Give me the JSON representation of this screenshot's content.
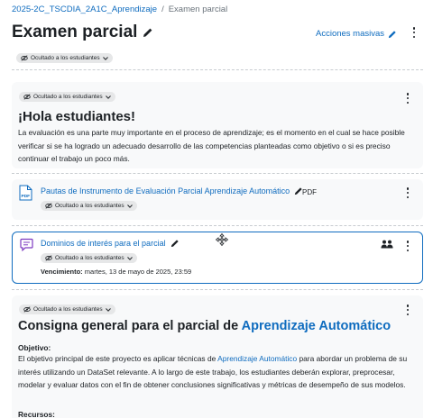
{
  "breadcrumb": {
    "course": "2025-2C_TSCDIA_2A1C_Aprendizaje",
    "separator": "/",
    "current": "Examen parcial"
  },
  "header": {
    "title": "Examen parcial",
    "bulk_actions": "Acciones masivas"
  },
  "hidden_badge": "Ocultado a los estudiantes",
  "section_intro": {
    "heading": "¡Hola estudiantes!",
    "body": "La evaluación es una parte muy importante en el proceso de aprendizaje; es el momento en el cual se hace posible verificar si se ha logrado un adecuado desarrollo de las competencias planteadas como objetivo o si es preciso continuar el trabajo un poco más."
  },
  "activity_file": {
    "name": "Pautas de Instrumento de Evaluación Parcial Aprendizaje Automático",
    "type": "PDF",
    "icon": "pdf-file-icon"
  },
  "activity_forum": {
    "name": "Dominios de interés para el parcial",
    "icon": "forum-icon",
    "due_label": "Vencimiento:",
    "due_value": "martes, 13 de mayo de 2025, 23:59",
    "group_icon": "group-mode-icon"
  },
  "consigna": {
    "heading_prefix": "Consigna general para el parcial de",
    "heading_highlight": "Aprendizaje Automático",
    "objective_label": "Objetivo:",
    "objective_text_1": "El objetivo principal de este proyecto es aplicar técnicas de",
    "objective_link": "Aprendizaje Automático",
    "objective_text_2": "para abordar un problema de su interés utilizando un DataSet relevante. A lo largo de este trabajo, los estudiantes deberán explorar, preprocesar, modelar y evaluar datos con el fin de obtener conclusiones significativas y métricas de desempeño de sus modelos.",
    "resources_label": "Recursos:"
  },
  "colors": {
    "link": "#0f6cbf",
    "text": "#1d2125",
    "badge_bg": "#e6e7e8",
    "card_bg": "#f8f9fa",
    "forum_icon": "#7d3ac0",
    "pdf_icon": "#0f6cbf"
  }
}
